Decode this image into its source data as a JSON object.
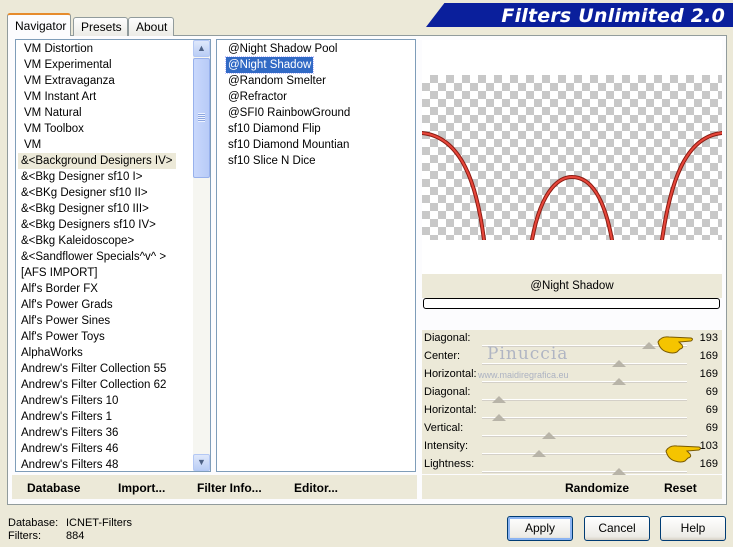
{
  "app": {
    "title": "Filters Unlimited 2.0"
  },
  "tabs": [
    {
      "label": "Navigator",
      "active": true
    },
    {
      "label": "Presets",
      "active": false
    },
    {
      "label": "About",
      "active": false
    }
  ],
  "categories": [
    "VM Distortion",
    "VM Experimental",
    "VM Extravaganza",
    "VM Instant Art",
    "VM Natural",
    "VM Toolbox",
    "VM",
    "&<Background Designers IV>",
    "&<Bkg Designer sf10 I>",
    "&<BKg Designer sf10 II>",
    "&<Bkg Designer sf10 III>",
    "&<Bkg Designers sf10 IV>",
    "&<Bkg Kaleidoscope>",
    "&<Sandflower Specials^v^ >",
    "[AFS IMPORT]",
    "Alf's Border FX",
    "Alf's Power Grads",
    "Alf's Power Sines",
    "Alf's Power Toys",
    "AlphaWorks",
    "Andrew's Filter Collection 55",
    "Andrew's Filter Collection 62",
    "Andrew's Filters 10",
    "Andrew's Filters 1",
    "Andrew's Filters 36",
    "Andrew's Filters 46",
    "Andrew's Filters 48"
  ],
  "current_category_index": 7,
  "filters": [
    "@Night Shadow Pool",
    "@Night Shadow",
    "@Random Smelter",
    "@Refractor",
    "@SFI0 RainbowGround",
    "sf10 Diamond Flip",
    "sf10 Diamond Mountian",
    "sf10 Slice N Dice"
  ],
  "selected_filter_index": 1,
  "preview": {
    "filter_name": "@Night Shadow",
    "curve_color": "#d8342a",
    "progress": 0
  },
  "sliders": [
    {
      "label": "Diagonal:",
      "value": "193"
    },
    {
      "label": "Center:",
      "value": "169"
    },
    {
      "label": "Horizontal:",
      "value": "169"
    },
    {
      "label": "Diagonal:",
      "value": "69"
    },
    {
      "label": "Horizontal:",
      "value": "69"
    },
    {
      "label": "Vertical:",
      "value": "69"
    },
    {
      "label": "Intensity:",
      "value": "103"
    },
    {
      "label": "Lightness:",
      "value": "169"
    }
  ],
  "watermark": {
    "name": "Pinuccia",
    "url": "www.maidiregrafica.eu"
  },
  "bottom_links": {
    "database": "Database",
    "import": "Import...",
    "filter_info": "Filter Info...",
    "editor": "Editor...",
    "randomize": "Randomize",
    "reset": "Reset"
  },
  "status": {
    "database_label": "Database:",
    "database_value": "ICNET-Filters",
    "filters_label": "Filters:",
    "filters_value": "884"
  },
  "buttons": {
    "apply": "Apply",
    "cancel": "Cancel",
    "help": "Help"
  },
  "colors": {
    "banner": "#0a1f9c",
    "selection": "#316ac5",
    "hand": "#f5c400"
  }
}
